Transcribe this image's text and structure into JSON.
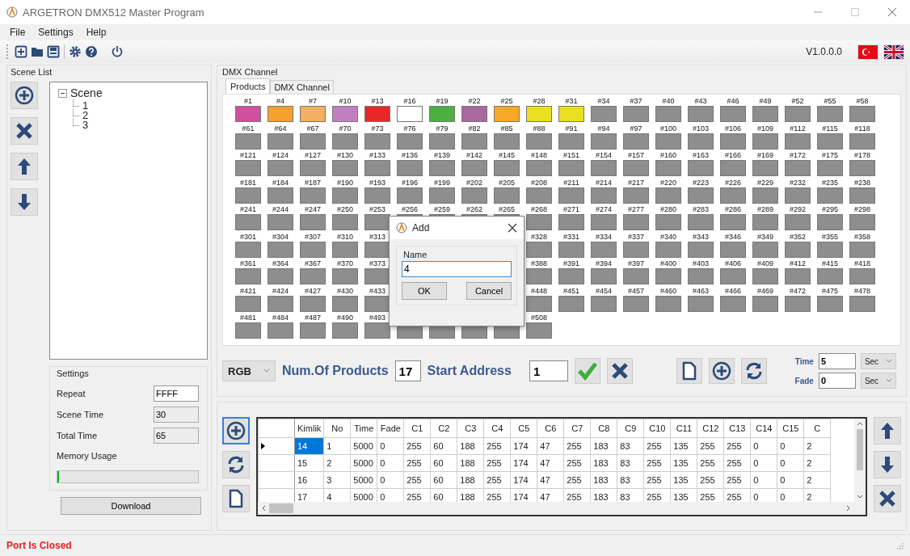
{
  "window": {
    "title": "ARGETRON DMX512 Master Program"
  },
  "menu": [
    "File",
    "Settings",
    "Help"
  ],
  "version": "V1.0.0.0",
  "scene_list": {
    "title": "Scene List",
    "tree": [
      {
        "label": "Scene",
        "expanded": true,
        "children": [
          {
            "label": "1"
          },
          {
            "label": "2"
          },
          {
            "label": "3"
          }
        ]
      }
    ]
  },
  "settings": {
    "title": "Settings",
    "fields": [
      {
        "label": "Repeat",
        "value": "FFFF",
        "disabled": false
      },
      {
        "label": "Scene Time",
        "value": "30",
        "disabled": true
      },
      {
        "label": "Total Time",
        "value": "65",
        "disabled": true
      }
    ],
    "memory": {
      "label": "Memory Usage",
      "level": 0.01
    },
    "download": "Download"
  },
  "dmx": {
    "title": "DMX Channel",
    "tabs": [
      {
        "label": "Products",
        "selected": true
      },
      {
        "label": "DMX Channel",
        "selected": false
      }
    ],
    "grid": [
      {
        "cells": [
          {
            "label": "#1",
            "color": "#d0509f"
          },
          {
            "label": "#4",
            "color": "#f5a030"
          },
          {
            "label": "#7",
            "color": "#f2b060"
          },
          {
            "label": "#10",
            "color": "#c080c0"
          },
          {
            "label": "#13",
            "color": "#e82828"
          },
          {
            "label": "#16",
            "color": "#ffffff"
          },
          {
            "label": "#19",
            "color": "#4cb040"
          },
          {
            "label": "#22",
            "color": "#a868a0"
          },
          {
            "label": "#25",
            "color": "#f8a828"
          },
          {
            "label": "#28",
            "color": "#e8e020"
          },
          {
            "label": "#31",
            "color": "#e8e020"
          },
          {
            "label": "#34",
            "color": "#8e8e8e"
          },
          {
            "label": "#37",
            "color": "#8e8e8e"
          },
          {
            "label": "#40",
            "color": "#8e8e8e"
          },
          {
            "label": "#43",
            "color": "#8e8e8e"
          },
          {
            "label": "#46",
            "color": "#8e8e8e"
          },
          {
            "label": "#49",
            "color": "#8e8e8e"
          },
          {
            "label": "#52",
            "color": "#8e8e8e"
          },
          {
            "label": "#55",
            "color": "#8e8e8e"
          },
          {
            "label": "#58",
            "color": "#8e8e8e"
          }
        ]
      },
      {
        "cells": [
          {
            "label": "#61",
            "color": "#8e8e8e"
          },
          {
            "label": "#64",
            "color": "#8e8e8e"
          },
          {
            "label": "#67",
            "color": "#8e8e8e"
          },
          {
            "label": "#70",
            "color": "#8e8e8e"
          },
          {
            "label": "#73",
            "color": "#8e8e8e"
          },
          {
            "label": "#76",
            "color": "#8e8e8e"
          },
          {
            "label": "#79",
            "color": "#8e8e8e"
          },
          {
            "label": "#82",
            "color": "#8e8e8e"
          },
          {
            "label": "#85",
            "color": "#8e8e8e"
          },
          {
            "label": "#88",
            "color": "#8e8e8e"
          },
          {
            "label": "#91",
            "color": "#8e8e8e"
          },
          {
            "label": "#94",
            "color": "#8e8e8e"
          },
          {
            "label": "#97",
            "color": "#8e8e8e"
          },
          {
            "label": "#100",
            "color": "#8e8e8e"
          },
          {
            "label": "#103",
            "color": "#8e8e8e"
          },
          {
            "label": "#106",
            "color": "#8e8e8e"
          },
          {
            "label": "#109",
            "color": "#8e8e8e"
          },
          {
            "label": "#112",
            "color": "#8e8e8e"
          },
          {
            "label": "#115",
            "color": "#8e8e8e"
          },
          {
            "label": "#118",
            "color": "#8e8e8e"
          }
        ]
      },
      {
        "cells": [
          {
            "label": "#121",
            "color": "#8e8e8e"
          },
          {
            "label": "#124",
            "color": "#8e8e8e"
          },
          {
            "label": "#127",
            "color": "#8e8e8e"
          },
          {
            "label": "#130",
            "color": "#8e8e8e"
          },
          {
            "label": "#133",
            "color": "#8e8e8e"
          },
          {
            "label": "#136",
            "color": "#8e8e8e"
          },
          {
            "label": "#139",
            "color": "#8e8e8e"
          },
          {
            "label": "#142",
            "color": "#8e8e8e"
          },
          {
            "label": "#145",
            "color": "#8e8e8e"
          },
          {
            "label": "#148",
            "color": "#8e8e8e"
          },
          {
            "label": "#151",
            "color": "#8e8e8e"
          },
          {
            "label": "#154",
            "color": "#8e8e8e"
          },
          {
            "label": "#157",
            "color": "#8e8e8e"
          },
          {
            "label": "#160",
            "color": "#8e8e8e"
          },
          {
            "label": "#163",
            "color": "#8e8e8e"
          },
          {
            "label": "#166",
            "color": "#8e8e8e"
          },
          {
            "label": "#169",
            "color": "#8e8e8e"
          },
          {
            "label": "#172",
            "color": "#8e8e8e"
          },
          {
            "label": "#175",
            "color": "#8e8e8e"
          },
          {
            "label": "#178",
            "color": "#8e8e8e"
          }
        ]
      },
      {
        "cells": [
          {
            "label": "#181",
            "color": "#8e8e8e"
          },
          {
            "label": "#184",
            "color": "#8e8e8e"
          },
          {
            "label": "#187",
            "color": "#8e8e8e"
          },
          {
            "label": "#190",
            "color": "#8e8e8e"
          },
          {
            "label": "#193",
            "color": "#8e8e8e"
          },
          {
            "label": "#196",
            "color": "#8e8e8e"
          },
          {
            "label": "#199",
            "color": "#8e8e8e"
          },
          {
            "label": "#202",
            "color": "#8e8e8e"
          },
          {
            "label": "#205",
            "color": "#8e8e8e"
          },
          {
            "label": "#208",
            "color": "#8e8e8e"
          },
          {
            "label": "#211",
            "color": "#8e8e8e"
          },
          {
            "label": "#214",
            "color": "#8e8e8e"
          },
          {
            "label": "#217",
            "color": "#8e8e8e"
          },
          {
            "label": "#220",
            "color": "#8e8e8e"
          },
          {
            "label": "#223",
            "color": "#8e8e8e"
          },
          {
            "label": "#226",
            "color": "#8e8e8e"
          },
          {
            "label": "#229",
            "color": "#8e8e8e"
          },
          {
            "label": "#232",
            "color": "#8e8e8e"
          },
          {
            "label": "#235",
            "color": "#8e8e8e"
          },
          {
            "label": "#238",
            "color": "#8e8e8e"
          }
        ]
      },
      {
        "cells": [
          {
            "label": "#241",
            "color": "#8e8e8e"
          },
          {
            "label": "#244",
            "color": "#8e8e8e"
          },
          {
            "label": "#247",
            "color": "#8e8e8e"
          },
          {
            "label": "#250",
            "color": "#8e8e8e"
          },
          {
            "label": "#253",
            "color": "#8e8e8e"
          },
          {
            "label": "#256",
            "color": "#8e8e8e"
          },
          {
            "label": "#259",
            "color": "#8e8e8e"
          },
          {
            "label": "#262",
            "color": "#8e8e8e"
          },
          {
            "label": "#265",
            "color": "#8e8e8e"
          },
          {
            "label": "#268",
            "color": "#8e8e8e"
          },
          {
            "label": "#271",
            "color": "#8e8e8e"
          },
          {
            "label": "#274",
            "color": "#8e8e8e"
          },
          {
            "label": "#277",
            "color": "#8e8e8e"
          },
          {
            "label": "#280",
            "color": "#8e8e8e"
          },
          {
            "label": "#283",
            "color": "#8e8e8e"
          },
          {
            "label": "#286",
            "color": "#8e8e8e"
          },
          {
            "label": "#289",
            "color": "#8e8e8e"
          },
          {
            "label": "#292",
            "color": "#8e8e8e"
          },
          {
            "label": "#295",
            "color": "#8e8e8e"
          },
          {
            "label": "#298",
            "color": "#8e8e8e"
          }
        ]
      },
      {
        "cells": [
          {
            "label": "#301",
            "color": "#8e8e8e"
          },
          {
            "label": "#304",
            "color": "#8e8e8e"
          },
          {
            "label": "#307",
            "color": "#8e8e8e"
          },
          {
            "label": "#310",
            "color": "#8e8e8e"
          },
          {
            "label": "#313",
            "color": "#8e8e8e"
          }
        ],
        "cells_after_dialog": [
          {
            "label": "#328",
            "color": "#8e8e8e"
          },
          {
            "label": "#331",
            "color": "#8e8e8e"
          },
          {
            "label": "#334",
            "color": "#8e8e8e"
          },
          {
            "label": "#337",
            "color": "#8e8e8e"
          },
          {
            "label": "#340",
            "color": "#8e8e8e"
          },
          {
            "label": "#343",
            "color": "#8e8e8e"
          },
          {
            "label": "#346",
            "color": "#8e8e8e"
          },
          {
            "label": "#349",
            "color": "#8e8e8e"
          },
          {
            "label": "#352",
            "color": "#8e8e8e"
          },
          {
            "label": "#355",
            "color": "#8e8e8e"
          },
          {
            "label": "#358",
            "color": "#8e8e8e"
          }
        ]
      },
      {
        "cells": [
          {
            "label": "#361",
            "color": "#8e8e8e"
          },
          {
            "label": "#364",
            "color": "#8e8e8e"
          },
          {
            "label": "#367",
            "color": "#8e8e8e"
          },
          {
            "label": "#370",
            "color": "#8e8e8e"
          },
          {
            "label": "#373",
            "color": "#8e8e8e"
          }
        ],
        "cells_after_dialog": [
          {
            "label": "#388",
            "color": "#8e8e8e"
          },
          {
            "label": "#391",
            "color": "#8e8e8e"
          },
          {
            "label": "#394",
            "color": "#8e8e8e"
          },
          {
            "label": "#397",
            "color": "#8e8e8e"
          },
          {
            "label": "#400",
            "color": "#8e8e8e"
          },
          {
            "label": "#403",
            "color": "#8e8e8e"
          },
          {
            "label": "#406",
            "color": "#8e8e8e"
          },
          {
            "label": "#409",
            "color": "#8e8e8e"
          },
          {
            "label": "#412",
            "color": "#8e8e8e"
          },
          {
            "label": "#415",
            "color": "#8e8e8e"
          },
          {
            "label": "#418",
            "color": "#8e8e8e"
          }
        ]
      },
      {
        "cells": [
          {
            "label": "#421",
            "color": "#8e8e8e"
          },
          {
            "label": "#424",
            "color": "#8e8e8e"
          },
          {
            "label": "#427",
            "color": "#8e8e8e"
          },
          {
            "label": "#430",
            "color": "#8e8e8e"
          },
          {
            "label": "#433",
            "color": "#8e8e8e"
          }
        ],
        "cells_after_dialog": [
          {
            "label": "#448",
            "color": "#8e8e8e"
          },
          {
            "label": "#451",
            "color": "#8e8e8e"
          },
          {
            "label": "#454",
            "color": "#8e8e8e"
          },
          {
            "label": "#457",
            "color": "#8e8e8e"
          },
          {
            "label": "#460",
            "color": "#8e8e8e"
          },
          {
            "label": "#463",
            "color": "#8e8e8e"
          },
          {
            "label": "#466",
            "color": "#8e8e8e"
          },
          {
            "label": "#469",
            "color": "#8e8e8e"
          },
          {
            "label": "#472",
            "color": "#8e8e8e"
          },
          {
            "label": "#475",
            "color": "#8e8e8e"
          },
          {
            "label": "#478",
            "color": "#8e8e8e"
          }
        ]
      },
      {
        "cells": [
          {
            "label": "#481",
            "color": "#8e8e8e"
          },
          {
            "label": "#484",
            "color": "#8e8e8e"
          },
          {
            "label": "#487",
            "color": "#8e8e8e"
          },
          {
            "label": "#490",
            "color": "#8e8e8e"
          },
          {
            "label": "#493",
            "color": "#8e8e8e"
          },
          {
            "color": "#8e8e8e"
          },
          {
            "color": "#8e8e8e"
          },
          {
            "color": "#8e8e8e"
          },
          {
            "color": "#8e8e8e"
          },
          {
            "label": "#508",
            "color": "#8e8e8e"
          }
        ]
      }
    ],
    "mode": "RGB",
    "num_label": "Num.Of Products",
    "num": "17",
    "start_label": "Start Address",
    "start": "1",
    "timing": [
      {
        "label": "Time",
        "value": "5",
        "unit": "Sec"
      },
      {
        "label": "Fade",
        "value": "0",
        "unit": "Sec"
      }
    ]
  },
  "table": {
    "columns": [
      "Kimlik",
      "No",
      "Time",
      "Fade",
      "C1",
      "C2",
      "C3",
      "C4",
      "C5",
      "C6",
      "C7",
      "C8",
      "C9",
      "C10",
      "C11",
      "C12",
      "C13",
      "C14",
      "C15",
      "C"
    ],
    "rows": [
      {
        "selected": true,
        "cells": [
          "14",
          "1",
          "5000",
          "0",
          "255",
          "60",
          "188",
          "255",
          "174",
          "47",
          "255",
          "183",
          "83",
          "255",
          "135",
          "255",
          "255",
          "0",
          "0",
          "2"
        ]
      },
      {
        "selected": false,
        "cells": [
          "15",
          "2",
          "5000",
          "0",
          "255",
          "60",
          "188",
          "255",
          "174",
          "47",
          "255",
          "183",
          "83",
          "255",
          "135",
          "255",
          "255",
          "0",
          "0",
          "2"
        ]
      },
      {
        "selected": false,
        "cells": [
          "16",
          "3",
          "5000",
          "0",
          "255",
          "60",
          "188",
          "255",
          "174",
          "47",
          "255",
          "183",
          "83",
          "255",
          "135",
          "255",
          "255",
          "0",
          "0",
          "2"
        ]
      },
      {
        "selected": false,
        "cells": [
          "17",
          "4",
          "5000",
          "0",
          "255",
          "60",
          "188",
          "255",
          "174",
          "47",
          "255",
          "183",
          "83",
          "255",
          "135",
          "255",
          "255",
          "0",
          "0",
          "2"
        ]
      }
    ]
  },
  "dialog": {
    "title": "Add",
    "group": "Name",
    "value": "4",
    "buttons": [
      "OK",
      "Cancel"
    ]
  },
  "status_bar": {
    "text": "Port Is Closed"
  }
}
